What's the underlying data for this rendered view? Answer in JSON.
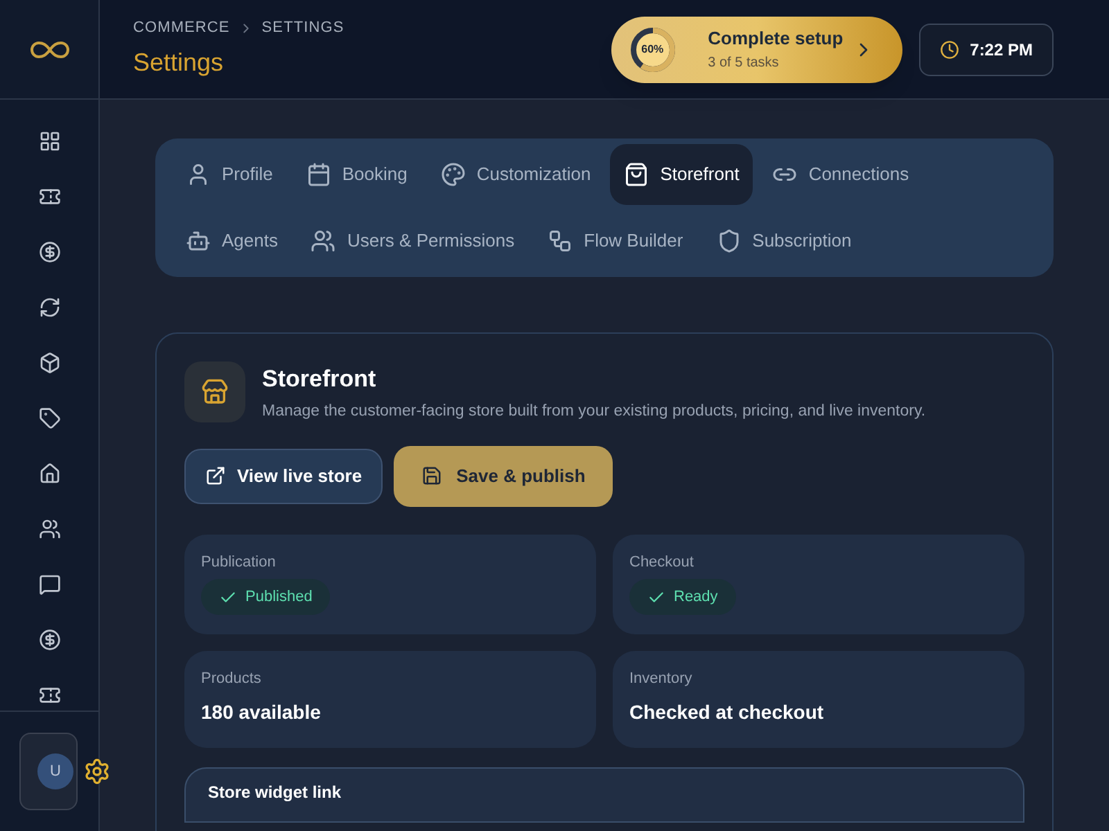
{
  "header": {
    "breadcrumb": [
      "COMMERCE",
      "SETTINGS"
    ],
    "title": "Settings",
    "setup": {
      "percent": "60%",
      "level": 0.6,
      "title": "Complete setup",
      "subtitle": "3 of 5 tasks"
    },
    "time": "7:22 PM"
  },
  "sidebar": {
    "items": [
      {
        "kind": "grid",
        "selected": false
      },
      {
        "kind": "ticket",
        "selected": false
      },
      {
        "kind": "dollar",
        "selected": false
      },
      {
        "kind": "refresh",
        "selected": false
      },
      {
        "kind": "box",
        "selected": false
      },
      {
        "kind": "tag",
        "selected": false
      },
      {
        "kind": "home",
        "selected": false
      },
      {
        "kind": "users",
        "selected": false
      },
      {
        "kind": "chat",
        "selected": false
      },
      {
        "kind": "dollar",
        "selected": false
      },
      {
        "kind": "ticket",
        "selected": false
      }
    ],
    "avatar": "U"
  },
  "tabs": [
    {
      "label": "Profile",
      "kind": "user",
      "selected": false
    },
    {
      "label": "Booking",
      "kind": "calendar",
      "selected": false
    },
    {
      "label": "Customization",
      "kind": "palette",
      "selected": false
    },
    {
      "label": "Storefront",
      "kind": "bag",
      "selected": true
    },
    {
      "label": "Connections",
      "kind": "link",
      "selected": false
    },
    {
      "label": "Agents",
      "kind": "bot",
      "selected": false
    },
    {
      "label": "Users & Permissions",
      "kind": "users",
      "selected": false
    },
    {
      "label": "Flow Builder",
      "kind": "flow",
      "selected": false
    },
    {
      "label": "Subscription",
      "kind": "shield",
      "selected": false
    }
  ],
  "panel": {
    "title": "Storefront",
    "description": "Manage the customer-facing store built from your existing products, pricing, and live inventory.",
    "buttons": [
      {
        "label": "View live store",
        "kind": "secondary"
      },
      {
        "label": "Save & publish",
        "kind": "primary"
      }
    ],
    "stats": [
      {
        "label": "Publication",
        "kind": "badge",
        "value": "Published"
      },
      {
        "label": "Checkout",
        "kind": "badge",
        "value": "Ready"
      },
      {
        "label": "Products",
        "kind": "text",
        "value": "180 available"
      },
      {
        "label": "Inventory",
        "kind": "text",
        "value": "Checked at checkout"
      }
    ],
    "widget": {
      "title": "Store widget link"
    }
  }
}
